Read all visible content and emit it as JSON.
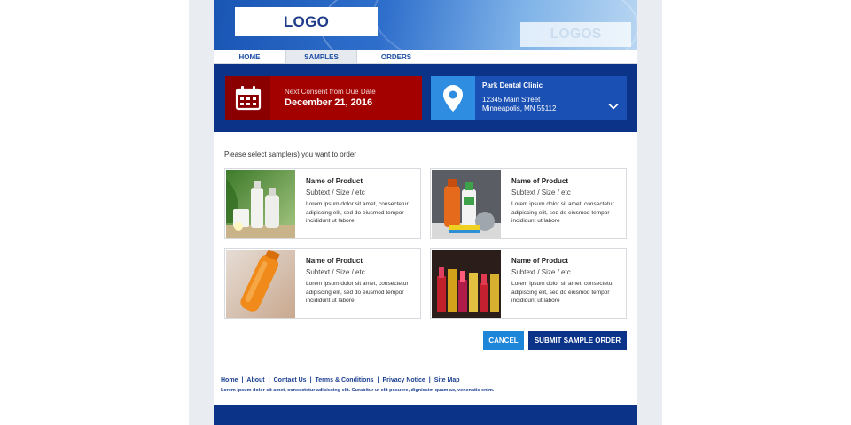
{
  "header": {
    "logo_text": "LOGO",
    "logos_text": "LOGOS"
  },
  "nav": {
    "items": [
      {
        "label": "HOME"
      },
      {
        "label": "SAMPLES",
        "active": true
      },
      {
        "label": "ORDERS"
      }
    ]
  },
  "consent": {
    "label": "Next Consent from Due Date",
    "date": "December 21, 2016",
    "icon": "calendar-icon",
    "color": "#a30000"
  },
  "clinic": {
    "name": "Park Dental Clinic",
    "address_line1": "12345 Main Street",
    "address_line2": "Minneapolis, MN 55112",
    "icon": "location-pin-icon",
    "expand_icon": "chevron-down-icon"
  },
  "main": {
    "prompt": "Please select sample(s) you want to order",
    "products": [
      {
        "name": "Name of Product",
        "subtext": "Subtext / Size / etc",
        "description": "Lorem ipsum dolor sit amet, consectetur adipiscing elit, sed do eiusmod tempor incididunt ut labore"
      },
      {
        "name": "Name of Product",
        "subtext": "Subtext / Size / etc",
        "description": "Lorem ipsum dolor sit amet, consectetur adipiscing elit, sed do eiusmod tempor incididunt ut labore"
      },
      {
        "name": "Name of Product",
        "subtext": "Subtext / Size / etc",
        "description": "Lorem ipsum dolor sit amet, consectetur adipiscing elit, sed do eiusmod tempor incididunt ut labore"
      },
      {
        "name": "Name of Product",
        "subtext": "Subtext / Size / etc",
        "description": "Lorem ipsum dolor sit amet, consectetur adipiscing elit, sed do eiusmod tempor incididunt ut labore"
      }
    ],
    "cancel_label": "CANCEL",
    "submit_label": "SUBMIT SAMPLE ORDER"
  },
  "footer": {
    "links": [
      "Home",
      "About",
      "Contact Us",
      "Terms & Conditions",
      "Privacy Notice",
      "Site Map"
    ],
    "separator": "|",
    "text": "Lorem ipsum dolor sit amet, consectetur adipiscing elit. Curabitur ut elit posuere, dignissim quam ac, venenatis enim."
  },
  "colors": {
    "brand_blue": "#0b3488",
    "accent_blue": "#1d86d8",
    "consent_red": "#a30000"
  }
}
